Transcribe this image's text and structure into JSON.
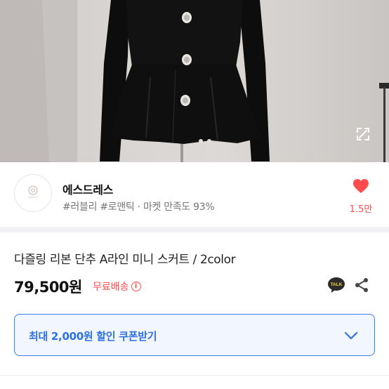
{
  "product_image": {
    "alt": "",
    "icon": "expand-icon"
  },
  "shop": {
    "logo_icon": "shop-logo-icon",
    "name": "에스드레스",
    "meta": "#러블리 #로맨틱 · 마켓 만족도 93%",
    "like_icon": "heart-icon",
    "like_count": "1.5만",
    "like_color": "#ff4b4b"
  },
  "product": {
    "title": "다즐링 리본 단추 A라인 미니 스커트 / 2color",
    "price": "79,500원",
    "shipping": "무료배송",
    "shipping_info_icon": "info-icon",
    "shipping_color": "#ff4a4a",
    "talk_icon": "kakao-talk-icon",
    "talk_label": "TALK",
    "share_icon": "share-icon"
  },
  "coupon": {
    "label": "최대 2,000원 할인 쿠폰받기",
    "icon": "chevron-down-icon",
    "accent_color": "#2f6fe4"
  }
}
